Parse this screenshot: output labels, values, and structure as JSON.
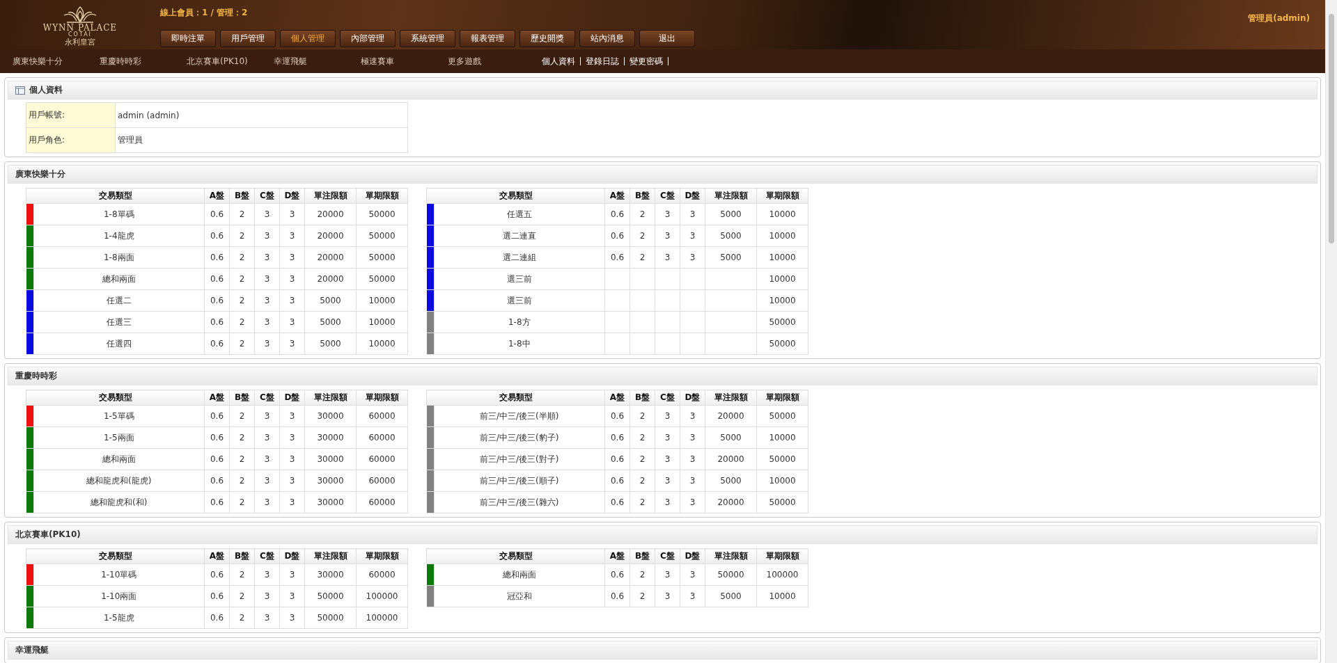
{
  "header": {
    "logo": {
      "name": "WYNN PALACE",
      "sub": "COTAI",
      "cn": "永利皇宮"
    },
    "online": "線上會員：1 / 管理：2",
    "user": "管理員(admin)",
    "nav": [
      {
        "label": "即時注單",
        "selected": false
      },
      {
        "label": "用戶管理",
        "selected": false
      },
      {
        "label": "個人管理",
        "selected": true
      },
      {
        "label": "內部管理",
        "selected": false
      },
      {
        "label": "系統管理",
        "selected": false
      },
      {
        "label": "報表管理",
        "selected": false
      },
      {
        "label": "歷史開獎",
        "selected": false
      },
      {
        "label": "站內消息",
        "selected": false
      },
      {
        "label": "退出",
        "selected": false
      }
    ],
    "games": [
      "廣東快樂十分",
      "重慶時時彩",
      "北京賽車(PK10)",
      "幸運飛艇",
      "極速賽車",
      "更多遊戲"
    ],
    "user_links": [
      "個人資料",
      "登錄日誌",
      "變更密碼"
    ]
  },
  "profile": {
    "title": "個人資料",
    "rows": [
      {
        "label": "用戶帳號:",
        "value": "admin (admin)"
      },
      {
        "label": "用戶角色:",
        "value": "管理員"
      }
    ]
  },
  "sections": [
    {
      "title": "廣東快樂十分",
      "tables": [
        {
          "columns": [
            "交易類型",
            "A盤",
            "B盤",
            "C盤",
            "D盤",
            "單注限額",
            "單期限額"
          ],
          "rows": [
            {
              "color": "#ee1111",
              "cells": [
                "1-8單碼",
                "0.6",
                "2",
                "3",
                "3",
                "20000",
                "50000"
              ]
            },
            {
              "color": "#0a7a0a",
              "cells": [
                "1-4龍虎",
                "0.6",
                "2",
                "3",
                "3",
                "20000",
                "50000"
              ]
            },
            {
              "color": "#0a7a0a",
              "cells": [
                "1-8兩面",
                "0.6",
                "2",
                "3",
                "3",
                "20000",
                "50000"
              ]
            },
            {
              "color": "#0a7a0a",
              "cells": [
                "總和兩面",
                "0.6",
                "2",
                "3",
                "3",
                "20000",
                "50000"
              ]
            },
            {
              "color": "#0a0ae0",
              "cells": [
                "任選二",
                "0.6",
                "2",
                "3",
                "3",
                "5000",
                "10000"
              ]
            },
            {
              "color": "#0a0ae0",
              "cells": [
                "任選三",
                "0.6",
                "2",
                "3",
                "3",
                "5000",
                "10000"
              ]
            },
            {
              "color": "#0a0ae0",
              "cells": [
                "任選四",
                "0.6",
                "2",
                "3",
                "3",
                "5000",
                "10000"
              ]
            }
          ]
        },
        {
          "columns": [
            "交易類型",
            "A盤",
            "B盤",
            "C盤",
            "D盤",
            "單注限額",
            "單期限額"
          ],
          "rows": [
            {
              "color": "#0a0ae0",
              "cells": [
                "任選五",
                "0.6",
                "2",
                "3",
                "3",
                "5000",
                "10000"
              ]
            },
            {
              "color": "#0a0ae0",
              "cells": [
                "選二連直",
                "0.6",
                "2",
                "3",
                "3",
                "5000",
                "10000"
              ]
            },
            {
              "color": "#0a0ae0",
              "cells": [
                "選二連組",
                "0.6",
                "2",
                "3",
                "3",
                "5000",
                "10000"
              ]
            },
            {
              "color": "#0a0ae0",
              "cells": [
                "選三前",
                null,
                null,
                null,
                null,
                null,
                "10000"
              ]
            },
            {
              "color": "#0a0ae0",
              "cells": [
                "選三前",
                null,
                null,
                null,
                null,
                null,
                "10000"
              ]
            },
            {
              "color": "#808080",
              "cells": [
                "1-8方",
                null,
                null,
                null,
                null,
                null,
                "50000"
              ]
            },
            {
              "color": "#808080",
              "cells": [
                "1-8中",
                null,
                null,
                null,
                null,
                null,
                "50000"
              ]
            }
          ]
        }
      ]
    },
    {
      "title": "重慶時時彩",
      "tables": [
        {
          "columns": [
            "交易類型",
            "A盤",
            "B盤",
            "C盤",
            "D盤",
            "單注限額",
            "單期限額"
          ],
          "rows": [
            {
              "color": "#ee1111",
              "cells": [
                "1-5單碼",
                "0.6",
                "2",
                "3",
                "3",
                "30000",
                "60000"
              ]
            },
            {
              "color": "#0a7a0a",
              "cells": [
                "1-5兩面",
                "0.6",
                "2",
                "3",
                "3",
                "30000",
                "60000"
              ]
            },
            {
              "color": "#0a7a0a",
              "cells": [
                "總和兩面",
                "0.6",
                "2",
                "3",
                "3",
                "30000",
                "60000"
              ]
            },
            {
              "color": "#0a7a0a",
              "cells": [
                "總和龍虎和(龍虎)",
                "0.6",
                "2",
                "3",
                "3",
                "30000",
                "60000"
              ]
            },
            {
              "color": "#0a7a0a",
              "cells": [
                "總和龍虎和(和)",
                "0.6",
                "2",
                "3",
                "3",
                "30000",
                "60000"
              ]
            }
          ]
        },
        {
          "columns": [
            "交易類型",
            "A盤",
            "B盤",
            "C盤",
            "D盤",
            "單注限額",
            "單期限額"
          ],
          "rows": [
            {
              "color": "#808080",
              "cells": [
                "前三/中三/後三(半順)",
                "0.6",
                "2",
                "3",
                "3",
                "20000",
                "50000"
              ]
            },
            {
              "color": "#808080",
              "cells": [
                "前三/中三/後三(豹子)",
                "0.6",
                "2",
                "3",
                "3",
                "5000",
                "10000"
              ]
            },
            {
              "color": "#808080",
              "cells": [
                "前三/中三/後三(對子)",
                "0.6",
                "2",
                "3",
                "3",
                "20000",
                "50000"
              ]
            },
            {
              "color": "#808080",
              "cells": [
                "前三/中三/後三(順子)",
                "0.6",
                "2",
                "3",
                "3",
                "5000",
                "10000"
              ]
            },
            {
              "color": "#808080",
              "cells": [
                "前三/中三/後三(雜六)",
                "0.6",
                "2",
                "3",
                "3",
                "20000",
                "50000"
              ]
            }
          ]
        }
      ]
    },
    {
      "title": "北京賽車(PK10)",
      "tables": [
        {
          "columns": [
            "交易類型",
            "A盤",
            "B盤",
            "C盤",
            "D盤",
            "單注限額",
            "單期限額"
          ],
          "rows": [
            {
              "color": "#ee1111",
              "cells": [
                "1-10單碼",
                "0.6",
                "2",
                "3",
                "3",
                "30000",
                "60000"
              ]
            },
            {
              "color": "#0a7a0a",
              "cells": [
                "1-10兩面",
                "0.6",
                "2",
                "3",
                "3",
                "50000",
                "100000"
              ]
            },
            {
              "color": "#0a7a0a",
              "cells": [
                "1-5龍虎",
                "0.6",
                "2",
                "3",
                "3",
                "50000",
                "100000"
              ]
            }
          ]
        },
        {
          "columns": [
            "交易類型",
            "A盤",
            "B盤",
            "C盤",
            "D盤",
            "單注限額",
            "單期限額"
          ],
          "rows": [
            {
              "color": "#0a7a0a",
              "cells": [
                "總和兩面",
                "0.6",
                "2",
                "3",
                "3",
                "50000",
                "100000"
              ]
            },
            {
              "color": "#808080",
              "cells": [
                "冠亞和",
                "0.6",
                "2",
                "3",
                "3",
                "5000",
                "10000"
              ]
            }
          ]
        }
      ]
    },
    {
      "title": "幸運飛艇"
    }
  ]
}
